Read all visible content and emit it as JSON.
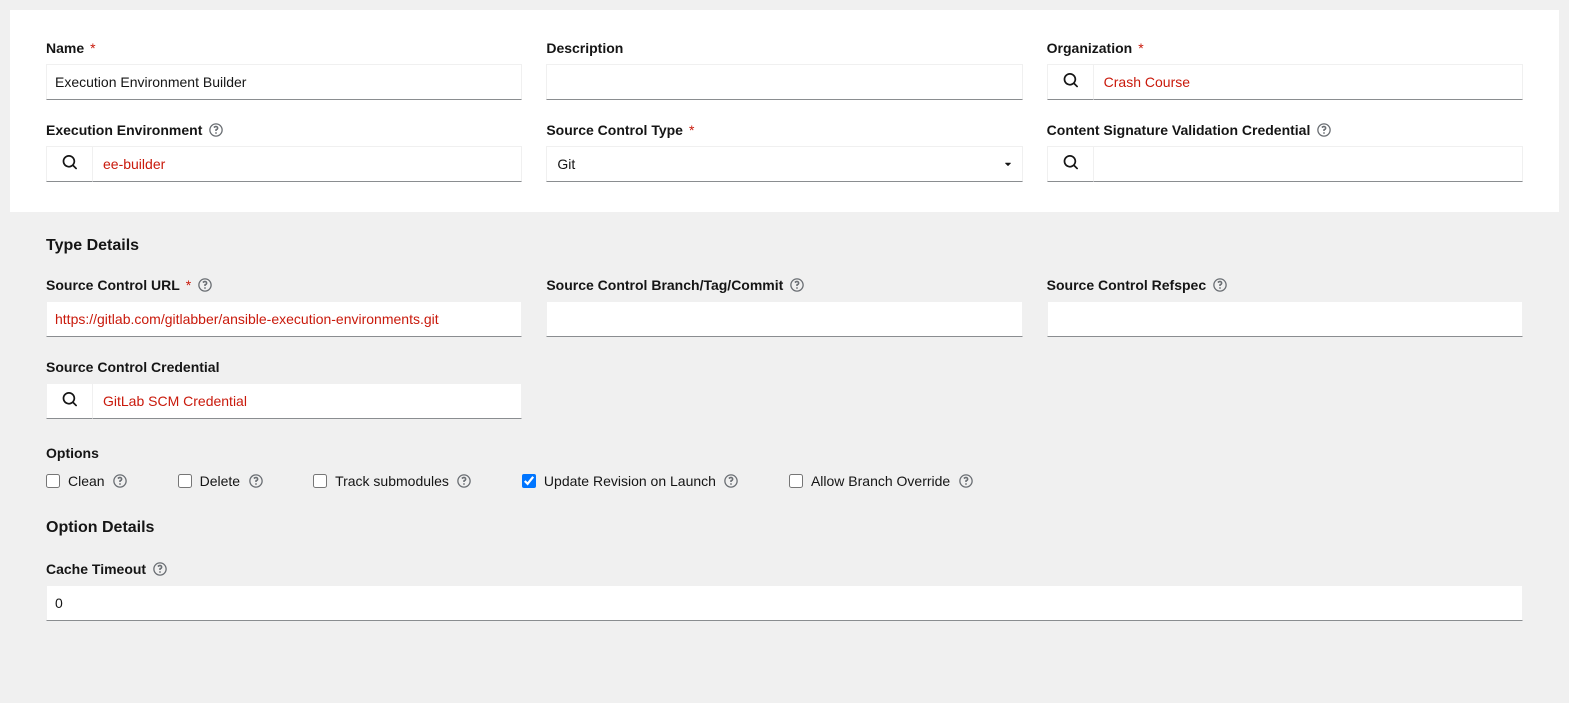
{
  "labels": {
    "name": "Name",
    "description": "Description",
    "organization": "Organization",
    "exec_env": "Execution Environment",
    "scm_type": "Source Control Type",
    "content_sig": "Content Signature Validation Credential",
    "type_details": "Type Details",
    "scm_url": "Source Control URL",
    "scm_branch": "Source Control Branch/Tag/Commit",
    "scm_refspec": "Source Control Refspec",
    "scm_credential": "Source Control Credential",
    "options": "Options",
    "option_details": "Option Details",
    "cache_timeout": "Cache Timeout"
  },
  "values": {
    "name": "Execution Environment Builder",
    "description": "",
    "organization": "Crash Course",
    "exec_env": "ee-builder",
    "scm_type": "Git",
    "content_sig": "",
    "scm_url": "https://gitlab.com/gitlabber/ansible-execution-environments.git",
    "scm_branch": "",
    "scm_refspec": "",
    "scm_credential": "GitLab SCM Credential",
    "cache_timeout": "0"
  },
  "options": {
    "clean": {
      "label": "Clean",
      "checked": false
    },
    "delete": {
      "label": "Delete",
      "checked": false
    },
    "track": {
      "label": "Track submodules",
      "checked": false
    },
    "update": {
      "label": "Update Revision on Launch",
      "checked": true
    },
    "allow_branch": {
      "label": "Allow Branch Override",
      "checked": false
    }
  }
}
